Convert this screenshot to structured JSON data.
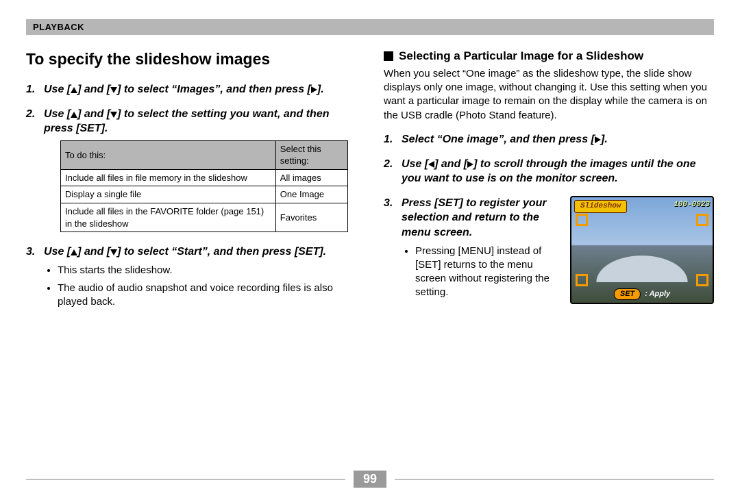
{
  "section": "Playback",
  "left": {
    "title": "To specify the slideshow images",
    "step1_a": "Use [",
    "step1_b": "] and [",
    "step1_c": "] to select “Images”, and then press [",
    "step1_d": "].",
    "step2_a": "Use [",
    "step2_b": "] and [",
    "step2_c": "] to select the setting you want, and then press [SET].",
    "table": {
      "head1": "To do this:",
      "head2": "Select this setting:",
      "r1c1": "Include all files in file memory in the slideshow",
      "r1c2": "All images",
      "r2c1": "Display a single file",
      "r2c2": "One Image",
      "r3c1": "Include all files in the FAVORITE folder (page 151) in the slideshow",
      "r3c2": "Favorites"
    },
    "step3_a": "Use [",
    "step3_b": "] and [",
    "step3_c": "] to select “Start”, and then press [SET].",
    "bullet1": "This starts the slideshow.",
    "bullet2": "The audio of audio snapshot and voice recording files is also played back."
  },
  "right": {
    "subhead": "Selecting a Particular Image for a Slideshow",
    "intro": "When you select “One image” as the slideshow type, the slide show displays only one image, without changing it. Use this setting when you want a particular image to remain on the display while the camera is on the USB cradle (Photo Stand feature).",
    "step1_a": "Select “One image”, and then press [",
    "step1_b": "].",
    "step2_a": "Use [",
    "step2_b": "] and [",
    "step2_c": "] to scroll through the images until the one you want to use is on the monitor screen.",
    "step3": "Press [SET] to register your selection and return to the menu screen.",
    "bullet1": "Pressing [MENU] instead of [SET] returns to the menu screen without registering the setting.",
    "camera": {
      "slideshow_label": "Slideshow",
      "image_id": "100-0023",
      "set_label": "SET",
      "apply_label": ": Apply"
    }
  },
  "page_number": "99"
}
